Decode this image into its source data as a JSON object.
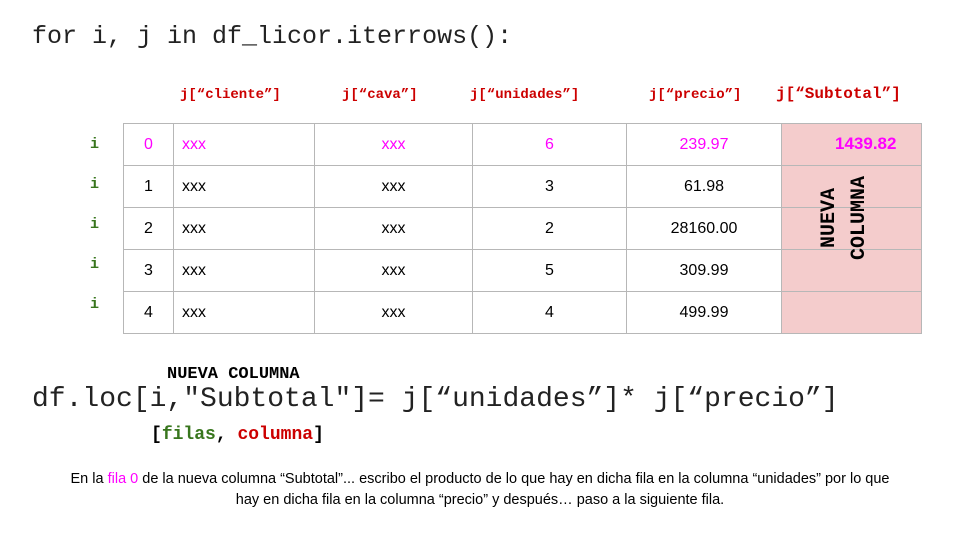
{
  "code_top": "for i, j in df_licor.iterrows():",
  "headers": {
    "cliente": "j[“cliente”]",
    "cava": "j[“cava”]",
    "unidades": "j[“unidades”]",
    "precio": "j[“precio”]",
    "subtotal": "j[“Subtotal”]"
  },
  "row_labels": [
    "i",
    "i",
    "i",
    "i",
    "i"
  ],
  "rows": [
    {
      "idx": "0",
      "cliente": "xxx",
      "cava": "xxx",
      "unidades": "6",
      "precio": "239.97"
    },
    {
      "idx": "1",
      "cliente": "xxx",
      "cava": "xxx",
      "unidades": "3",
      "precio": "61.98"
    },
    {
      "idx": "2",
      "cliente": "xxx",
      "cava": "xxx",
      "unidades": "2",
      "precio": "28160.00"
    },
    {
      "idx": "3",
      "cliente": "xxx",
      "cava": "xxx",
      "unidades": "5",
      "precio": "309.99"
    },
    {
      "idx": "4",
      "cliente": "xxx",
      "cava": "xxx",
      "unidades": "4",
      "precio": "499.99"
    }
  ],
  "subtotal_value": "1439.82",
  "nueva_columna_vertical": [
    "NUEVA",
    "COLUMNA"
  ],
  "nueva_columna_label": "NUEVA COLUMNA",
  "code_bottom": "df.loc[i,\"Subtotal\"]= j[“unidades”]* j[“precio”]",
  "args": {
    "open": "[",
    "filas": "filas",
    "sep": ", ",
    "columna": "columna",
    "close": "]"
  },
  "caption": {
    "part1": "En la ",
    "highlight": "fila 0",
    "part2": " de la nueva columna “Subtotal”... escribo el producto de lo que hay en dicha fila en la columna “unidades” por lo que hay en dicha fila en la columna “precio” y después… paso a la siguiente fila."
  },
  "colors": {
    "header": "#cc0000",
    "index_label": "#38761d",
    "highlight": "#ff00ff",
    "subtotal_bg": "#f4cccc"
  }
}
